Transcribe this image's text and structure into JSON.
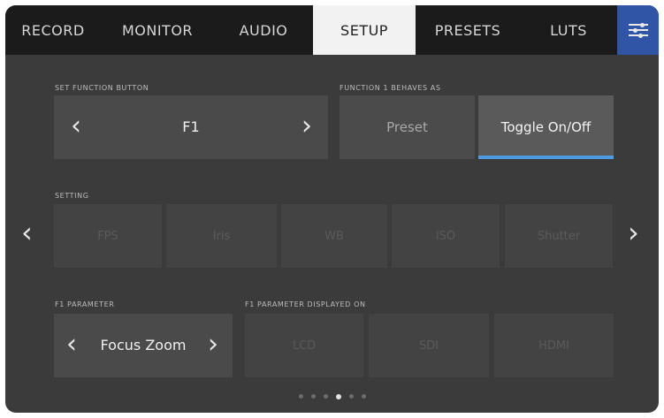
{
  "tabs": [
    {
      "label": "RECORD",
      "active": false
    },
    {
      "label": "MONITOR",
      "active": false
    },
    {
      "label": "AUDIO",
      "active": false
    },
    {
      "label": "SETUP",
      "active": true
    },
    {
      "label": "PRESETS",
      "active": false
    },
    {
      "label": "LUTS",
      "active": false
    }
  ],
  "settings_icon": "sliders-icon",
  "function_button": {
    "label": "SET FUNCTION BUTTON",
    "value": "F1",
    "prev_icon": "chevron-left-icon",
    "next_icon": "chevron-right-icon"
  },
  "behaves_as": {
    "label": "FUNCTION 1 BEHAVES AS",
    "options": [
      {
        "label": "Preset",
        "selected": false
      },
      {
        "label": "Toggle On/Off",
        "selected": true
      }
    ],
    "accent": "#4e9be0"
  },
  "setting": {
    "label": "SETTING",
    "options": [
      "FPS",
      "Iris",
      "WB",
      "ISO",
      "Shutter"
    ]
  },
  "parameter": {
    "label": "F1 PARAMETER",
    "value": "Focus Zoom"
  },
  "displayed_on": {
    "label": "F1 PARAMETER DISPLAYED ON",
    "options": [
      "LCD",
      "SDI",
      "HDMI"
    ]
  },
  "pagination": {
    "pages": 6,
    "current": 4
  }
}
